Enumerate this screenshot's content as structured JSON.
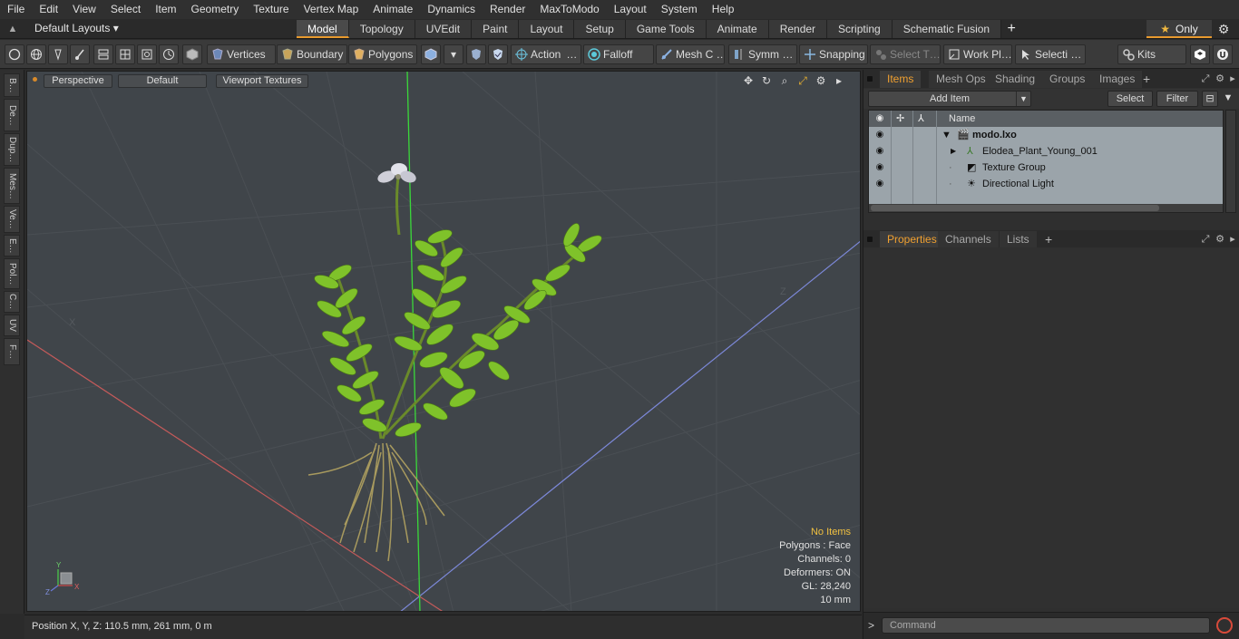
{
  "menu": [
    "File",
    "Edit",
    "View",
    "Select",
    "Item",
    "Geometry",
    "Texture",
    "Vertex Map",
    "Animate",
    "Dynamics",
    "Render",
    "MaxToModo",
    "Layout",
    "System",
    "Help"
  ],
  "layout_selector": "Default Layouts ▾",
  "mode_tabs": [
    "Model",
    "Topology",
    "UVEdit",
    "Paint",
    "Layout",
    "Setup",
    "Game Tools",
    "Animate",
    "Render",
    "Scripting",
    "Schematic Fusion"
  ],
  "active_mode_tab": "Model",
  "only_label": "Only",
  "toolbar": {
    "vertices": "Vertices",
    "boundary": "Boundary",
    "polygons": "Polygons",
    "action": "Action",
    "action_more": "…",
    "falloff": "Falloff",
    "meshc": "Mesh C …",
    "symm": "Symm …",
    "snapping": "Snapping",
    "select_t": "Select T…",
    "workpl": "Work Pl…",
    "selecti": "Selecti …",
    "kits": "Kits"
  },
  "left_tabs": [
    "B…",
    "De…",
    "Dup…",
    "Mes…",
    "Ve…",
    "E…",
    "Pol…",
    "C…",
    "UV",
    "F…"
  ],
  "viewport": {
    "view_mode": "Perspective",
    "shading": "Default",
    "textures": "Viewport Textures",
    "info": {
      "items": "No Items",
      "polygons": "Polygons : Face",
      "channels": "Channels: 0",
      "deformers": "Deformers: ON",
      "gl": "GL: 28,240",
      "scale": "10 mm"
    },
    "axis_x": "X",
    "axis_y": "Y",
    "axis_z": "Z"
  },
  "status": {
    "position": "Position X, Y, Z:   110.5 mm, 261 mm, 0 m"
  },
  "items_panel": {
    "tabs": [
      "Items",
      "Mesh Ops",
      "Shading",
      "Groups",
      "Images"
    ],
    "active_tab": "Items",
    "add_item": "Add Item",
    "select": "Select",
    "filter": "Filter",
    "col_name": "Name",
    "rows": [
      {
        "name": "modo.lxo",
        "indent": 0
      },
      {
        "name": "Elodea_Plant_Young_001",
        "indent": 1
      },
      {
        "name": "Texture Group",
        "indent": 1
      },
      {
        "name": "Directional Light",
        "indent": 1
      }
    ]
  },
  "properties_panel": {
    "tabs": [
      "Properties",
      "Channels",
      "Lists"
    ],
    "active_tab": "Properties"
  },
  "command": {
    "placeholder": "Command"
  },
  "colors": {
    "accent": "#e89a2e",
    "viewport_bg": "#3e4246",
    "list_bg": "#9ba4aa",
    "axis_y": "#30d030",
    "axis_x": "#d04848",
    "axis_z": "#6a78d8"
  }
}
